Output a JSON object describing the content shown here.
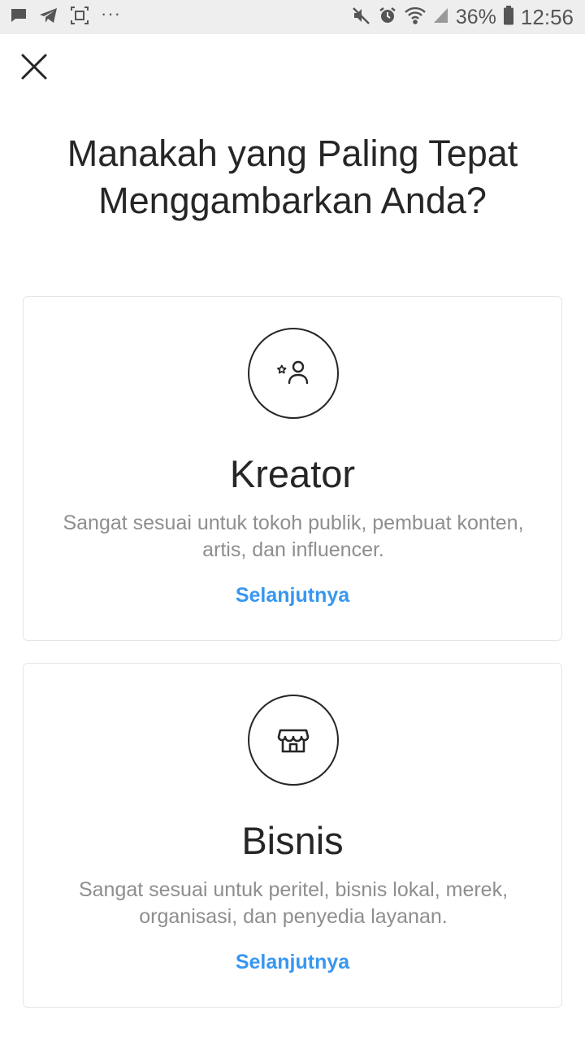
{
  "status_bar": {
    "battery": "36%",
    "time": "12:56",
    "left_icons": [
      "message-icon",
      "telegram-icon",
      "screenshot-icon",
      "more-dots-icon"
    ],
    "right_icons": [
      "mute-icon",
      "alarm-icon",
      "wifi-icon",
      "signal-icon",
      "battery-icon"
    ]
  },
  "header": {
    "close_icon": "close-icon",
    "title": "Manakah yang Paling Tepat Menggambarkan Anda?"
  },
  "options": [
    {
      "icon": "creator-star-person-icon",
      "title": "Kreator",
      "description": "Sangat sesuai untuk tokoh publik, pembuat konten, artis, dan influencer.",
      "action": "Selanjutnya"
    },
    {
      "icon": "storefront-icon",
      "title": "Bisnis",
      "description": "Sangat sesuai untuk peritel, bisnis lokal, merek, organisasi, dan penyedia layanan.",
      "action": "Selanjutnya"
    }
  ],
  "colors": {
    "status_bar_bg": "#eeeeee",
    "text_primary": "#262626",
    "text_secondary": "#8e8e8e",
    "link": "#3897f0",
    "card_border": "#e6e6e6"
  }
}
